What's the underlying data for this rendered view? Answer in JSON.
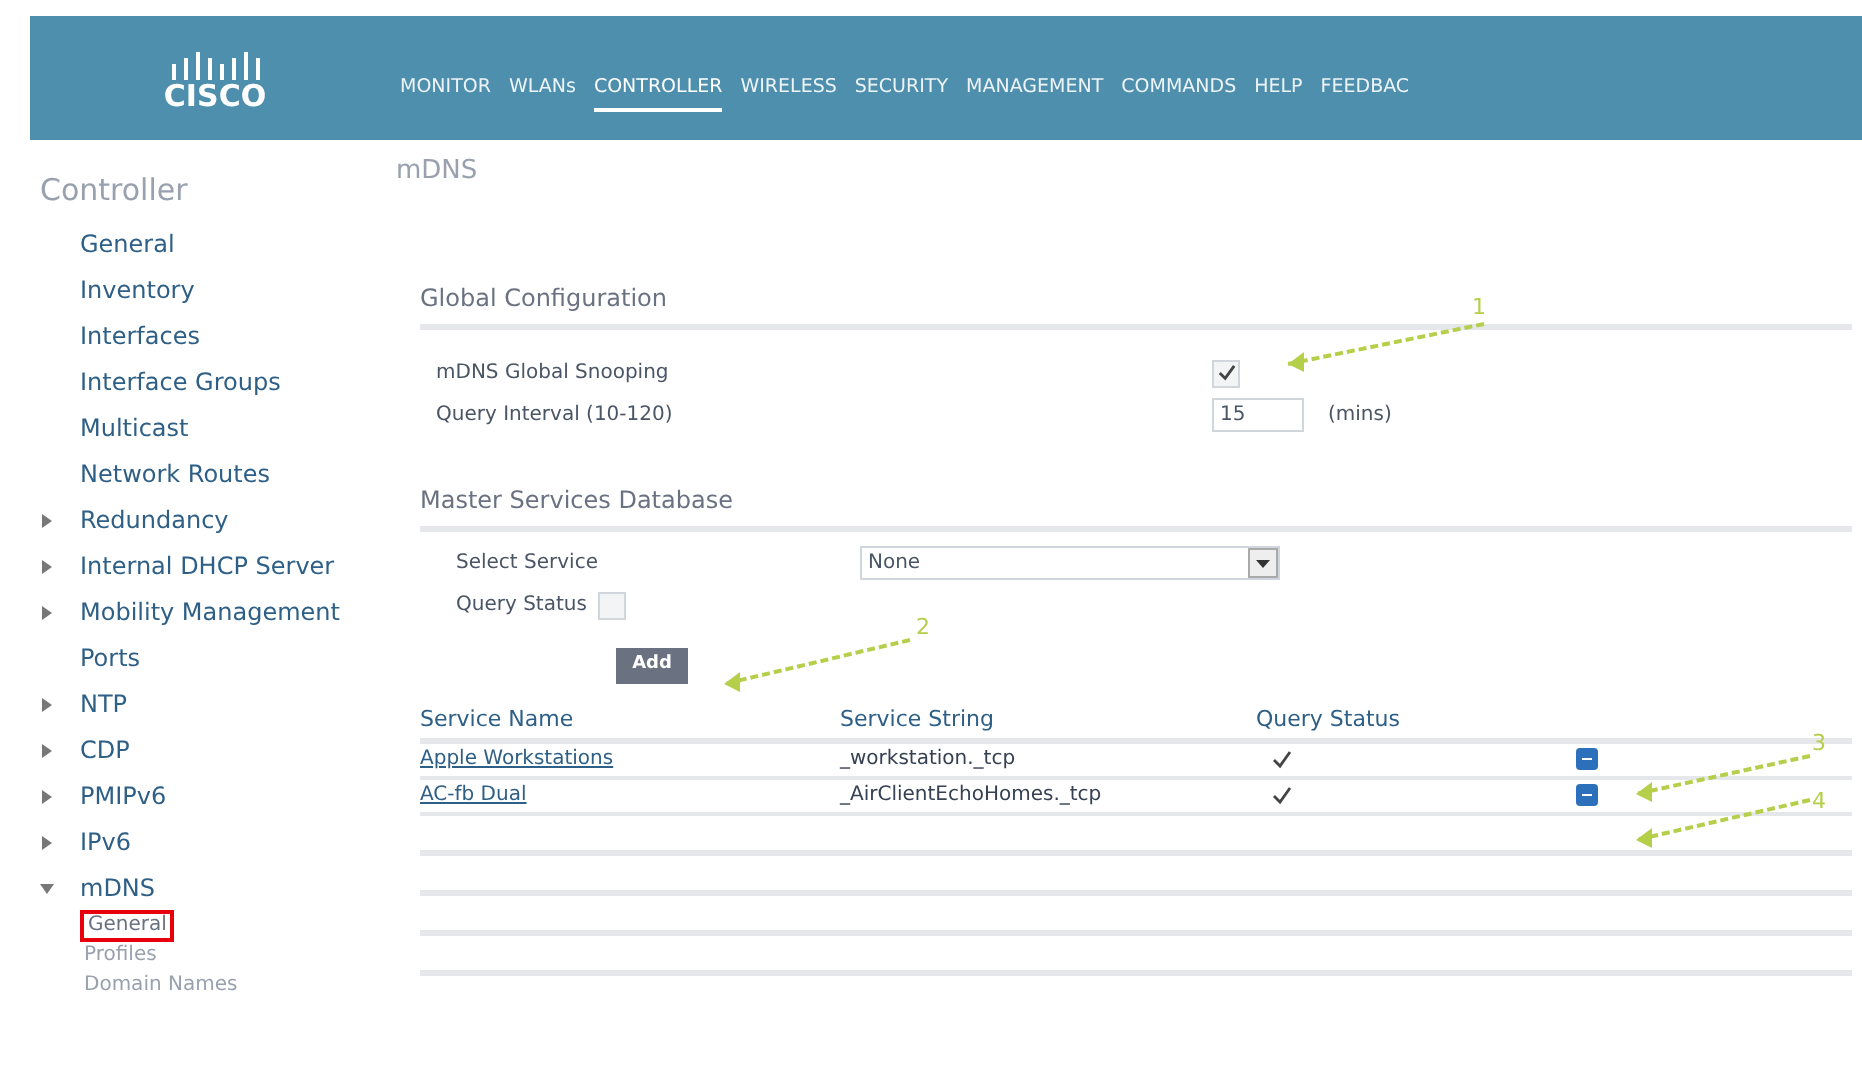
{
  "logo": {
    "text": "CISCO"
  },
  "menu": [
    {
      "label": "MONITOR",
      "selected": false
    },
    {
      "label": "WLANs",
      "selected": false
    },
    {
      "label": "CONTROLLER",
      "selected": true
    },
    {
      "label": "WIRELESS",
      "selected": false
    },
    {
      "label": "SECURITY",
      "selected": false
    },
    {
      "label": "MANAGEMENT",
      "selected": false
    },
    {
      "label": "COMMANDS",
      "selected": false
    },
    {
      "label": "HELP",
      "selected": false
    },
    {
      "label": "FEEDBAC",
      "selected": false
    }
  ],
  "sidebar": {
    "title": "Controller",
    "items": [
      {
        "label": "General",
        "kind": "link"
      },
      {
        "label": "Inventory",
        "kind": "link"
      },
      {
        "label": "Interfaces",
        "kind": "link"
      },
      {
        "label": "Interface Groups",
        "kind": "link"
      },
      {
        "label": "Multicast",
        "kind": "link"
      },
      {
        "label": "Network Routes",
        "kind": "link"
      },
      {
        "label": "Redundancy",
        "kind": "group",
        "expanded": false
      },
      {
        "label": "Internal DHCP Server",
        "kind": "group",
        "expanded": false
      },
      {
        "label": "Mobility Management",
        "kind": "group",
        "expanded": false
      },
      {
        "label": "Ports",
        "kind": "link"
      },
      {
        "label": "NTP",
        "kind": "group",
        "expanded": false
      },
      {
        "label": "CDP",
        "kind": "group",
        "expanded": false
      },
      {
        "label": "PMIPv6",
        "kind": "group",
        "expanded": false
      },
      {
        "label": "IPv6",
        "kind": "group",
        "expanded": false
      },
      {
        "label": "mDNS",
        "kind": "group",
        "expanded": true,
        "children": [
          {
            "label": "General",
            "selected": true
          },
          {
            "label": "Profiles",
            "selected": false
          },
          {
            "label": "Domain Names",
            "selected": false
          }
        ]
      }
    ]
  },
  "page_title": "mDNS",
  "global": {
    "heading": "Global Configuration",
    "snooping_label": "mDNS Global Snooping",
    "snooping_checked": true,
    "interval_label": "Query Interval (10-120)",
    "interval_value": "15",
    "interval_unit": "(mins)"
  },
  "master": {
    "heading": "Master Services Database",
    "select_label": "Select Service",
    "select_value": "None",
    "query_label": "Query Status",
    "query_checked": false,
    "add_button": "Add"
  },
  "table": {
    "columns": [
      "Service Name",
      "Service String",
      "Query Status"
    ],
    "rows": [
      {
        "name": "Apple Workstations",
        "string": "_workstation._tcp",
        "query": true
      },
      {
        "name": "AC-fb Dual",
        "string": "_AirClientEchoHomes._tcp",
        "query": true
      }
    ]
  },
  "annotations": [
    "1",
    "2",
    "3",
    "4"
  ]
}
